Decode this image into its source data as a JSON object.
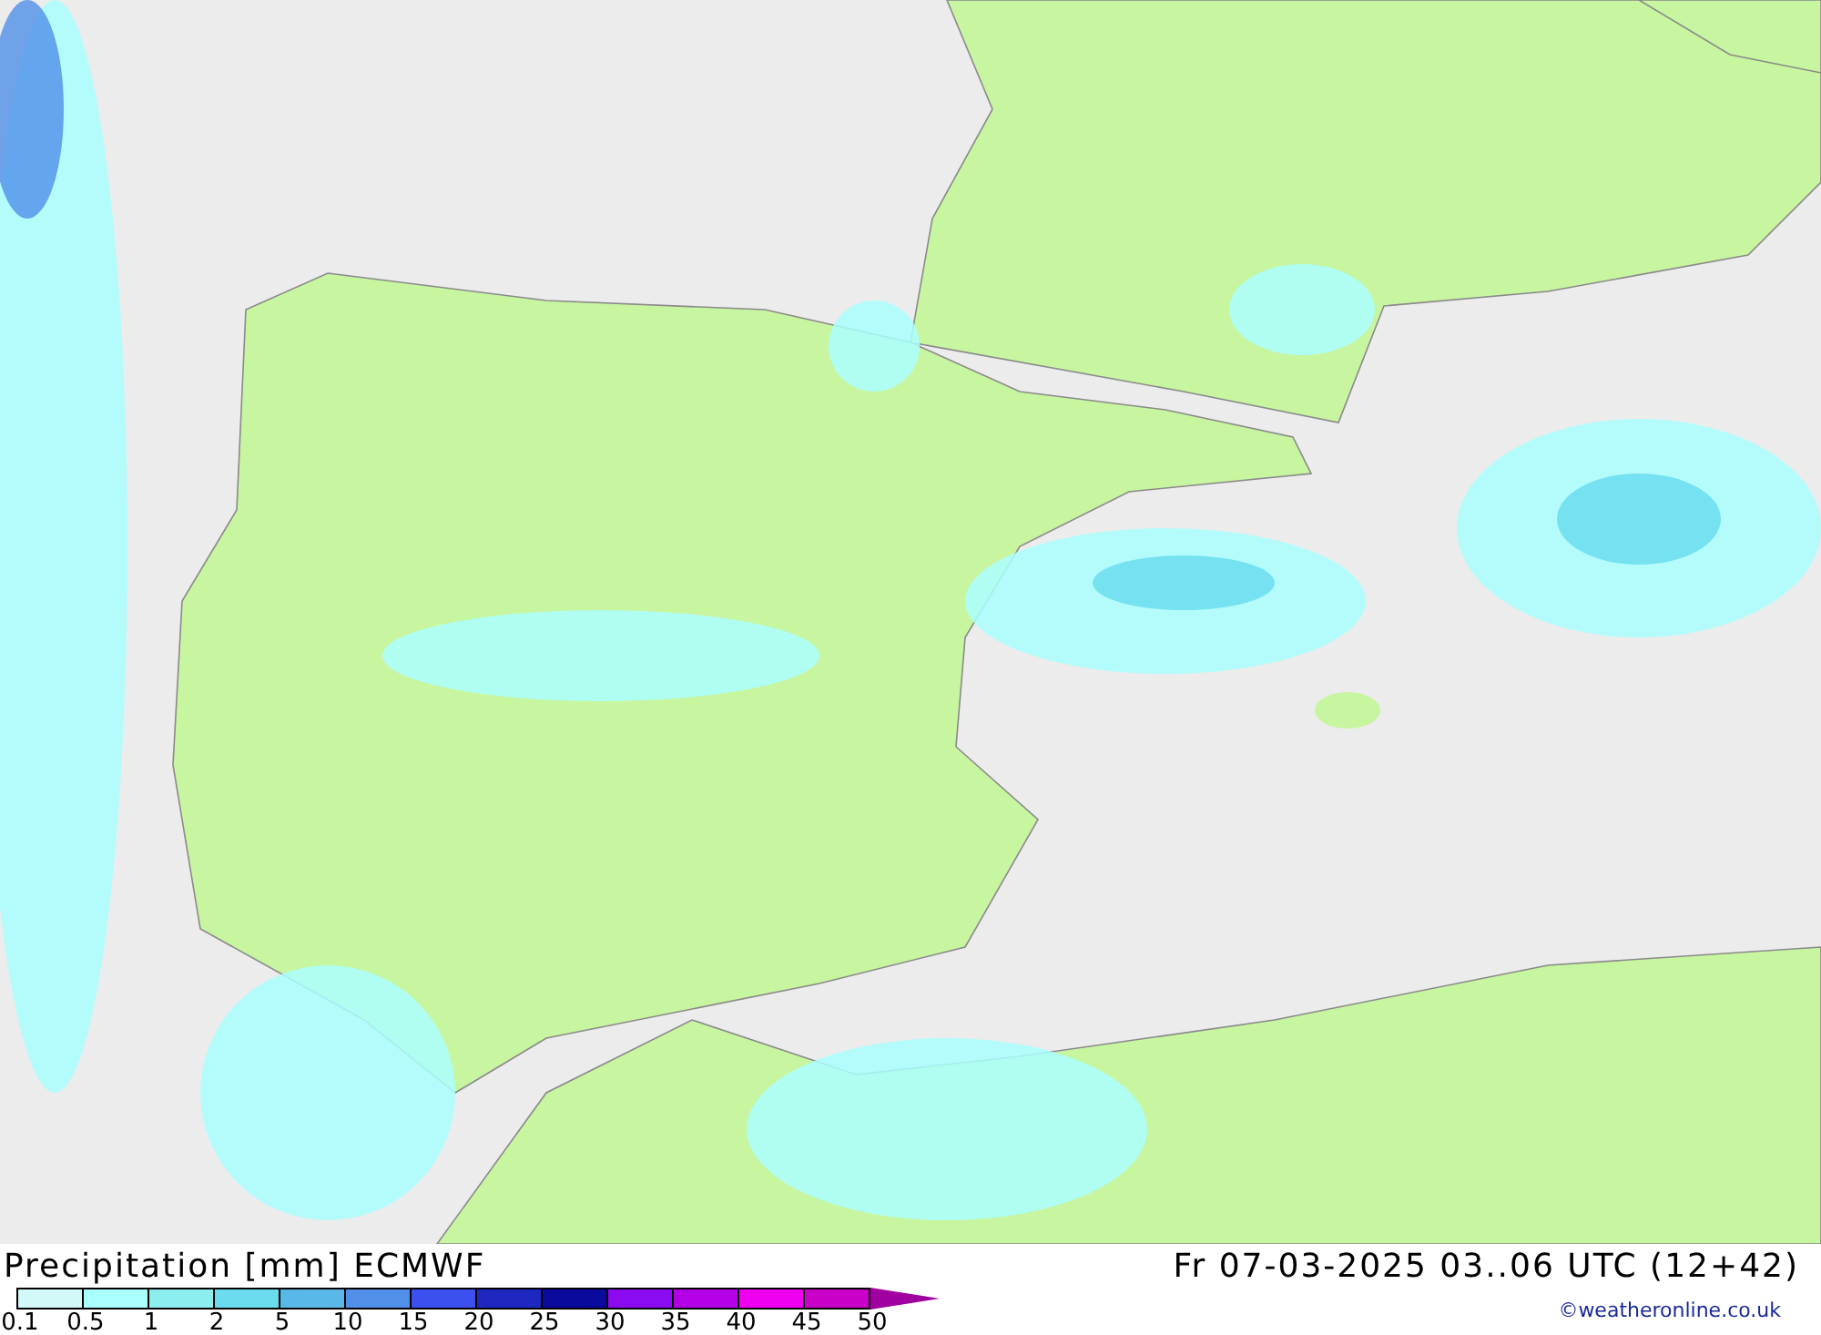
{
  "map": {
    "kind": "precipitation"
  },
  "title": {
    "label": "Precipitation [mm]",
    "model": "ECMWF"
  },
  "valid_time": {
    "day": "Fr",
    "date": "07-03-2025",
    "hours": "03..06 UTC",
    "run": "(12+42)"
  },
  "legend": {
    "swatches": [
      {
        "color": "#d2f8f8"
      },
      {
        "color": "#aaffff"
      },
      {
        "color": "#8ceeee"
      },
      {
        "color": "#6adcee"
      },
      {
        "color": "#5ab8e8"
      },
      {
        "color": "#5090e8"
      },
      {
        "color": "#3c50f0"
      },
      {
        "color": "#1e28c0"
      },
      {
        "color": "#0a0a9c"
      },
      {
        "color": "#8c0af0"
      },
      {
        "color": "#b400e6"
      },
      {
        "color": "#f000f0"
      },
      {
        "color": "#c800c8"
      }
    ],
    "arrow": {
      "color": "#a000a0"
    },
    "labels": [
      "0.1",
      "0.5",
      "1",
      "2",
      "5",
      "10",
      "15",
      "20",
      "25",
      "30",
      "35",
      "40",
      "45",
      "50"
    ]
  },
  "credit": "©weatheronline.co.uk"
}
